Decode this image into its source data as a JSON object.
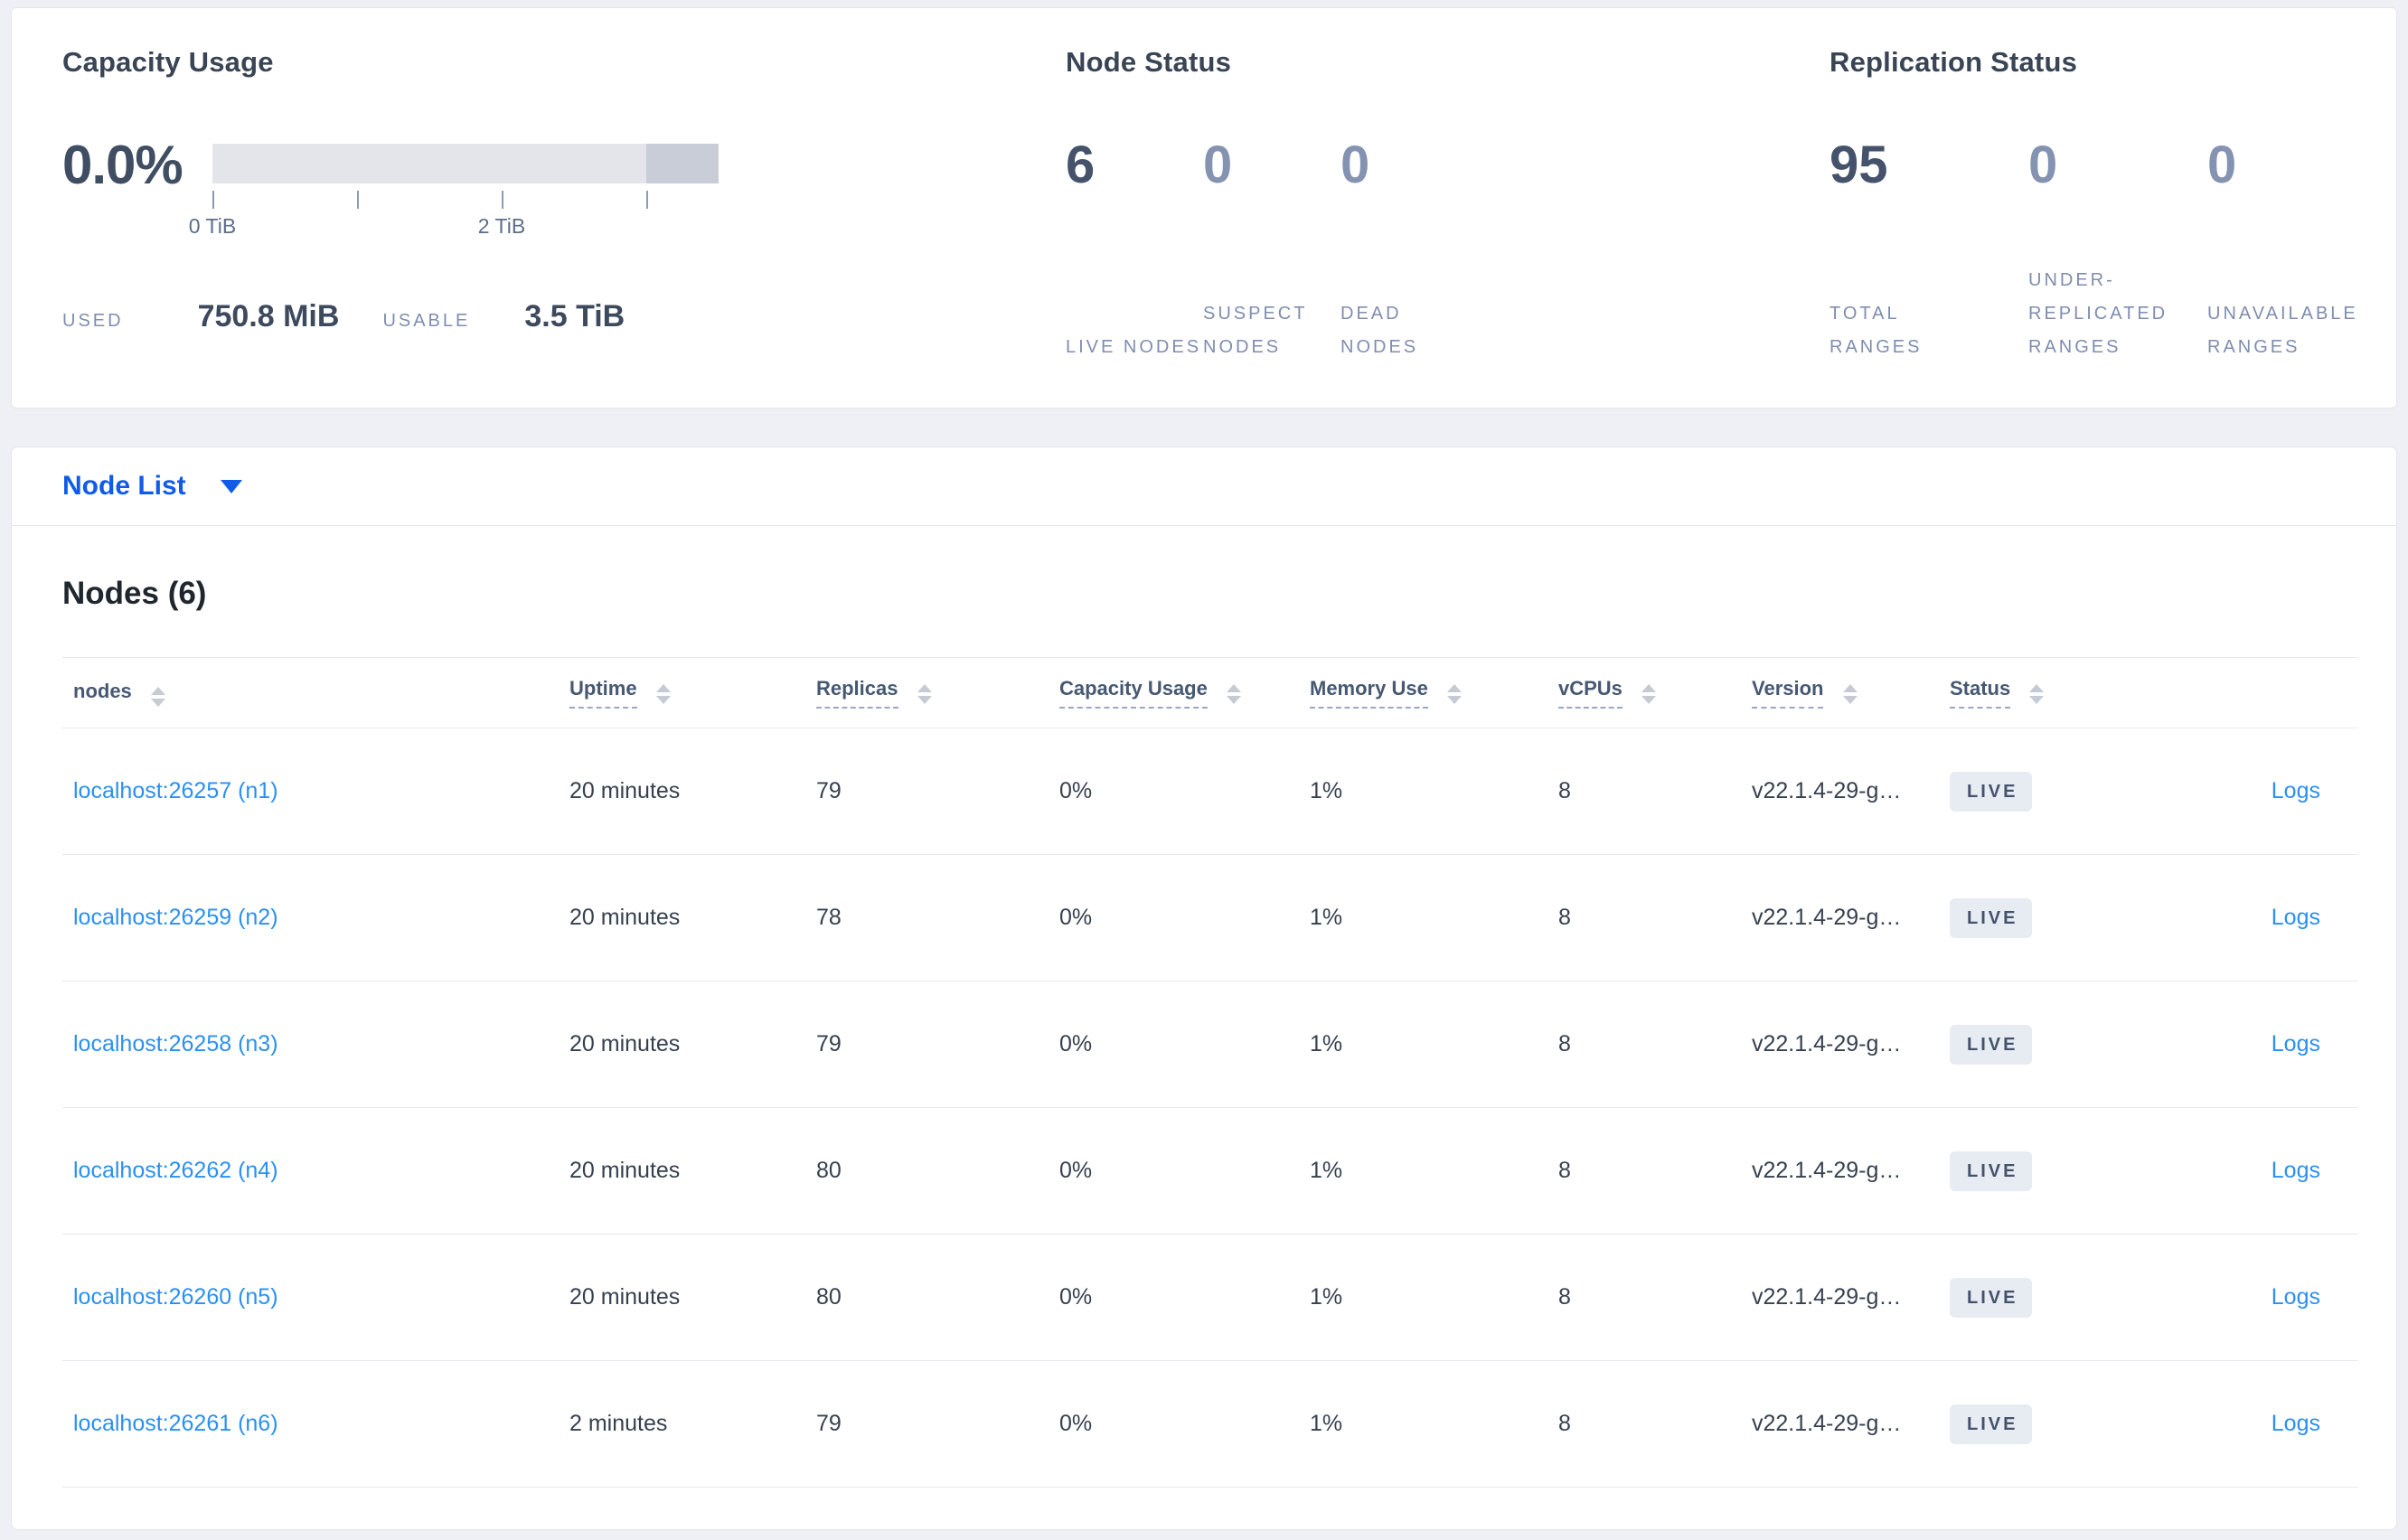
{
  "summary": {
    "capacity": {
      "title": "Capacity Usage",
      "percent": "0.0%",
      "axis_ticks": [
        {
          "label": "0 TiB",
          "position_pct": 0
        },
        {
          "label": "",
          "position_pct": 28.57
        },
        {
          "label": "2 TiB",
          "position_pct": 57.14
        },
        {
          "label": "",
          "position_pct": 85.71
        }
      ],
      "bar": {
        "track_color": "#e3e5eb",
        "reserved_segment_color": "#c9cdd7",
        "reserved_segment_pct": 14.3
      },
      "used_label": "USED",
      "used_value": "750.8 MiB",
      "usable_label": "USABLE",
      "usable_value": "3.5 TiB"
    },
    "node_status": {
      "title": "Node Status",
      "metrics": [
        {
          "value": "6",
          "label": "LIVE NODES"
        },
        {
          "value": "0",
          "label": "SUSPECT NODES"
        },
        {
          "value": "0",
          "label": "DEAD NODES"
        }
      ]
    },
    "replication_status": {
      "title": "Replication Status",
      "metrics": [
        {
          "value": "95",
          "label": "TOTAL RANGES"
        },
        {
          "value": "0",
          "label": "UNDER-REPLICATED RANGES"
        },
        {
          "value": "0",
          "label": "UNAVAILABLE RANGES"
        }
      ]
    }
  },
  "view_selector": {
    "label": "Node List"
  },
  "nodes": {
    "heading": "Nodes (6)",
    "columns": [
      {
        "label": "nodes"
      },
      {
        "label": "Uptime"
      },
      {
        "label": "Replicas"
      },
      {
        "label": "Capacity Usage"
      },
      {
        "label": "Memory Use"
      },
      {
        "label": "vCPUs"
      },
      {
        "label": "Version"
      },
      {
        "label": "Status"
      }
    ],
    "rows": [
      {
        "address": "localhost:26257 (n1)",
        "uptime": "20 minutes",
        "replicas": "79",
        "capacity_usage": "0%",
        "memory_use": "1%",
        "vcpus": "8",
        "version": "v22.1.4-29-g…",
        "status": "LIVE",
        "logs": "Logs"
      },
      {
        "address": "localhost:26259 (n2)",
        "uptime": "20 minutes",
        "replicas": "78",
        "capacity_usage": "0%",
        "memory_use": "1%",
        "vcpus": "8",
        "version": "v22.1.4-29-g…",
        "status": "LIVE",
        "logs": "Logs"
      },
      {
        "address": "localhost:26258 (n3)",
        "uptime": "20 minutes",
        "replicas": "79",
        "capacity_usage": "0%",
        "memory_use": "1%",
        "vcpus": "8",
        "version": "v22.1.4-29-g…",
        "status": "LIVE",
        "logs": "Logs"
      },
      {
        "address": "localhost:26262 (n4)",
        "uptime": "20 minutes",
        "replicas": "80",
        "capacity_usage": "0%",
        "memory_use": "1%",
        "vcpus": "8",
        "version": "v22.1.4-29-g…",
        "status": "LIVE",
        "logs": "Logs"
      },
      {
        "address": "localhost:26260 (n5)",
        "uptime": "20 minutes",
        "replicas": "80",
        "capacity_usage": "0%",
        "memory_use": "1%",
        "vcpus": "8",
        "version": "v22.1.4-29-g…",
        "status": "LIVE",
        "logs": "Logs"
      },
      {
        "address": "localhost:26261 (n6)",
        "uptime": "2 minutes",
        "replicas": "79",
        "capacity_usage": "0%",
        "memory_use": "1%",
        "vcpus": "8",
        "version": "v22.1.4-29-g…",
        "status": "LIVE",
        "logs": "Logs"
      }
    ]
  },
  "colors": {
    "page_background": "#eef0f5",
    "panel_background": "#ffffff",
    "selector_blue": "#105ce8",
    "link_blue": "#2b90f0",
    "dark_metric": "#44536b",
    "muted_metric": "#8593b2",
    "badge_background": "#e7ebf2"
  }
}
